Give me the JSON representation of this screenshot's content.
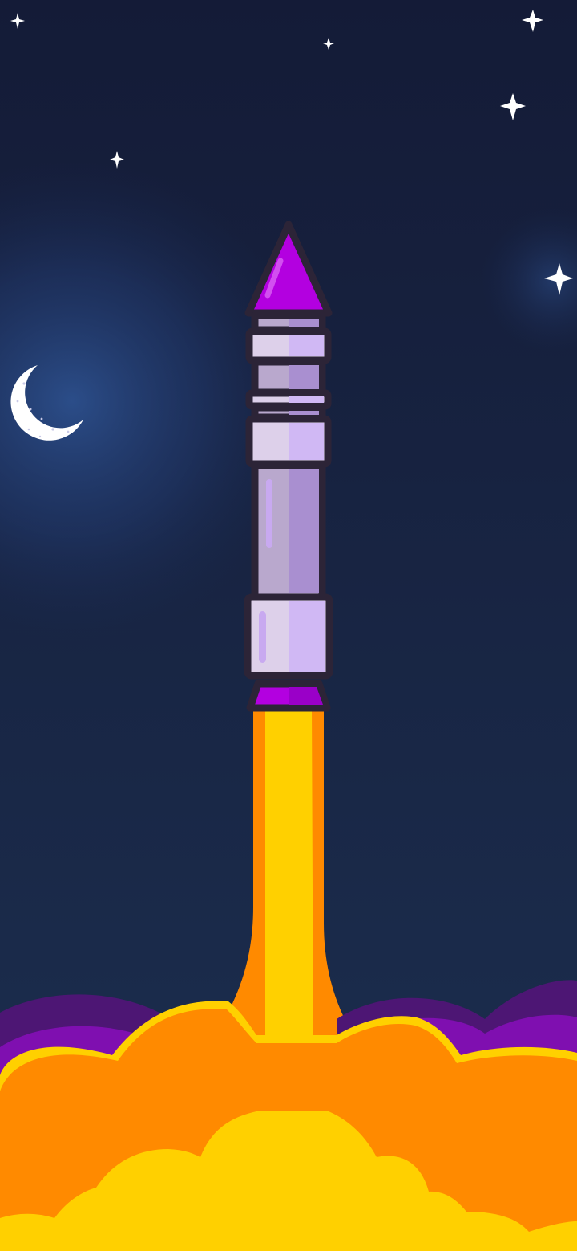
{
  "scene": {
    "sky_top": "#141b37",
    "sky_bottom": "#1c2f50",
    "moon_glow": "#2a4d8f"
  },
  "moon": {
    "color": "#ffffff",
    "crater_color": "#c9c9e6"
  },
  "stars": {
    "color": "#ffffff",
    "count": 6
  },
  "rocket": {
    "nose_color": "#b300e0",
    "nose_highlight": "#d24ff0",
    "body_light": "#ddd0ea",
    "body_mid": "#b9a8cd",
    "body_accent": "#c8a9f0",
    "outline": "#2c2437",
    "fin_color": "#b300e0"
  },
  "exhaust": {
    "flame_outer": "#ff8a00",
    "flame_inner": "#ffd000",
    "smoke_dark": "#4d1674",
    "smoke_light": "#7f0fb0"
  }
}
